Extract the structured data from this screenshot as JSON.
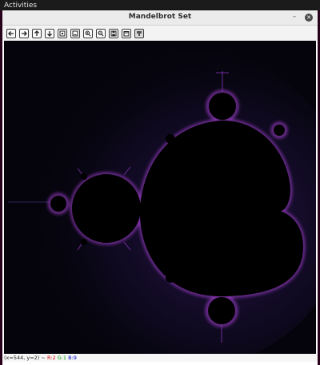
{
  "topbar": {
    "activities": "Activities"
  },
  "window": {
    "title": "Mandelbrot Set",
    "minimize_glyph": "–",
    "close_glyph": "✕"
  },
  "toolbar": {
    "buttons": [
      {
        "name": "pan-left-icon"
      },
      {
        "name": "pan-right-icon"
      },
      {
        "name": "pan-up-icon"
      },
      {
        "name": "pan-down-icon"
      },
      {
        "name": "zoom-to-rect-icon"
      },
      {
        "name": "zoom-fit-icon"
      },
      {
        "name": "zoom-in-icon"
      },
      {
        "name": "zoom-out-icon"
      },
      {
        "name": "save-image-icon"
      },
      {
        "name": "copy-image-icon"
      },
      {
        "name": "properties-icon"
      }
    ]
  },
  "status": {
    "coords": "(x=544, y=2) ~",
    "r": "R:2",
    "g": "G:1",
    "b": "B:9"
  },
  "colors": {
    "fractal_interior": "#000000",
    "fractal_fringe": "#b044e0",
    "fractal_halo": "#5a2a9a",
    "background": "#05040c"
  }
}
